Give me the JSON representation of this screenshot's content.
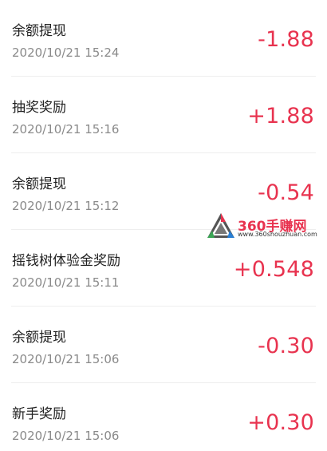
{
  "transactions": [
    {
      "title": "余额提现",
      "time": "2020/10/21 15:24",
      "amount": "-1.88"
    },
    {
      "title": "抽奖奖励",
      "time": "2020/10/21 15:16",
      "amount": "+1.88"
    },
    {
      "title": "余额提现",
      "time": "2020/10/21 15:12",
      "amount": "-0.54"
    },
    {
      "title": "摇钱树体验金奖励",
      "time": "2020/10/21 15:11",
      "amount": "+0.548"
    },
    {
      "title": "余额提现",
      "time": "2020/10/21 15:06",
      "amount": "-0.30"
    },
    {
      "title": "新手奖励",
      "time": "2020/10/21 15:06",
      "amount": "+0.30"
    }
  ],
  "watermark": {
    "brand": "360手赚网",
    "url": "www.360shouzhuan.com"
  },
  "colors": {
    "amount": "#e8334f",
    "title": "#222222",
    "time": "#8a8a8a"
  }
}
